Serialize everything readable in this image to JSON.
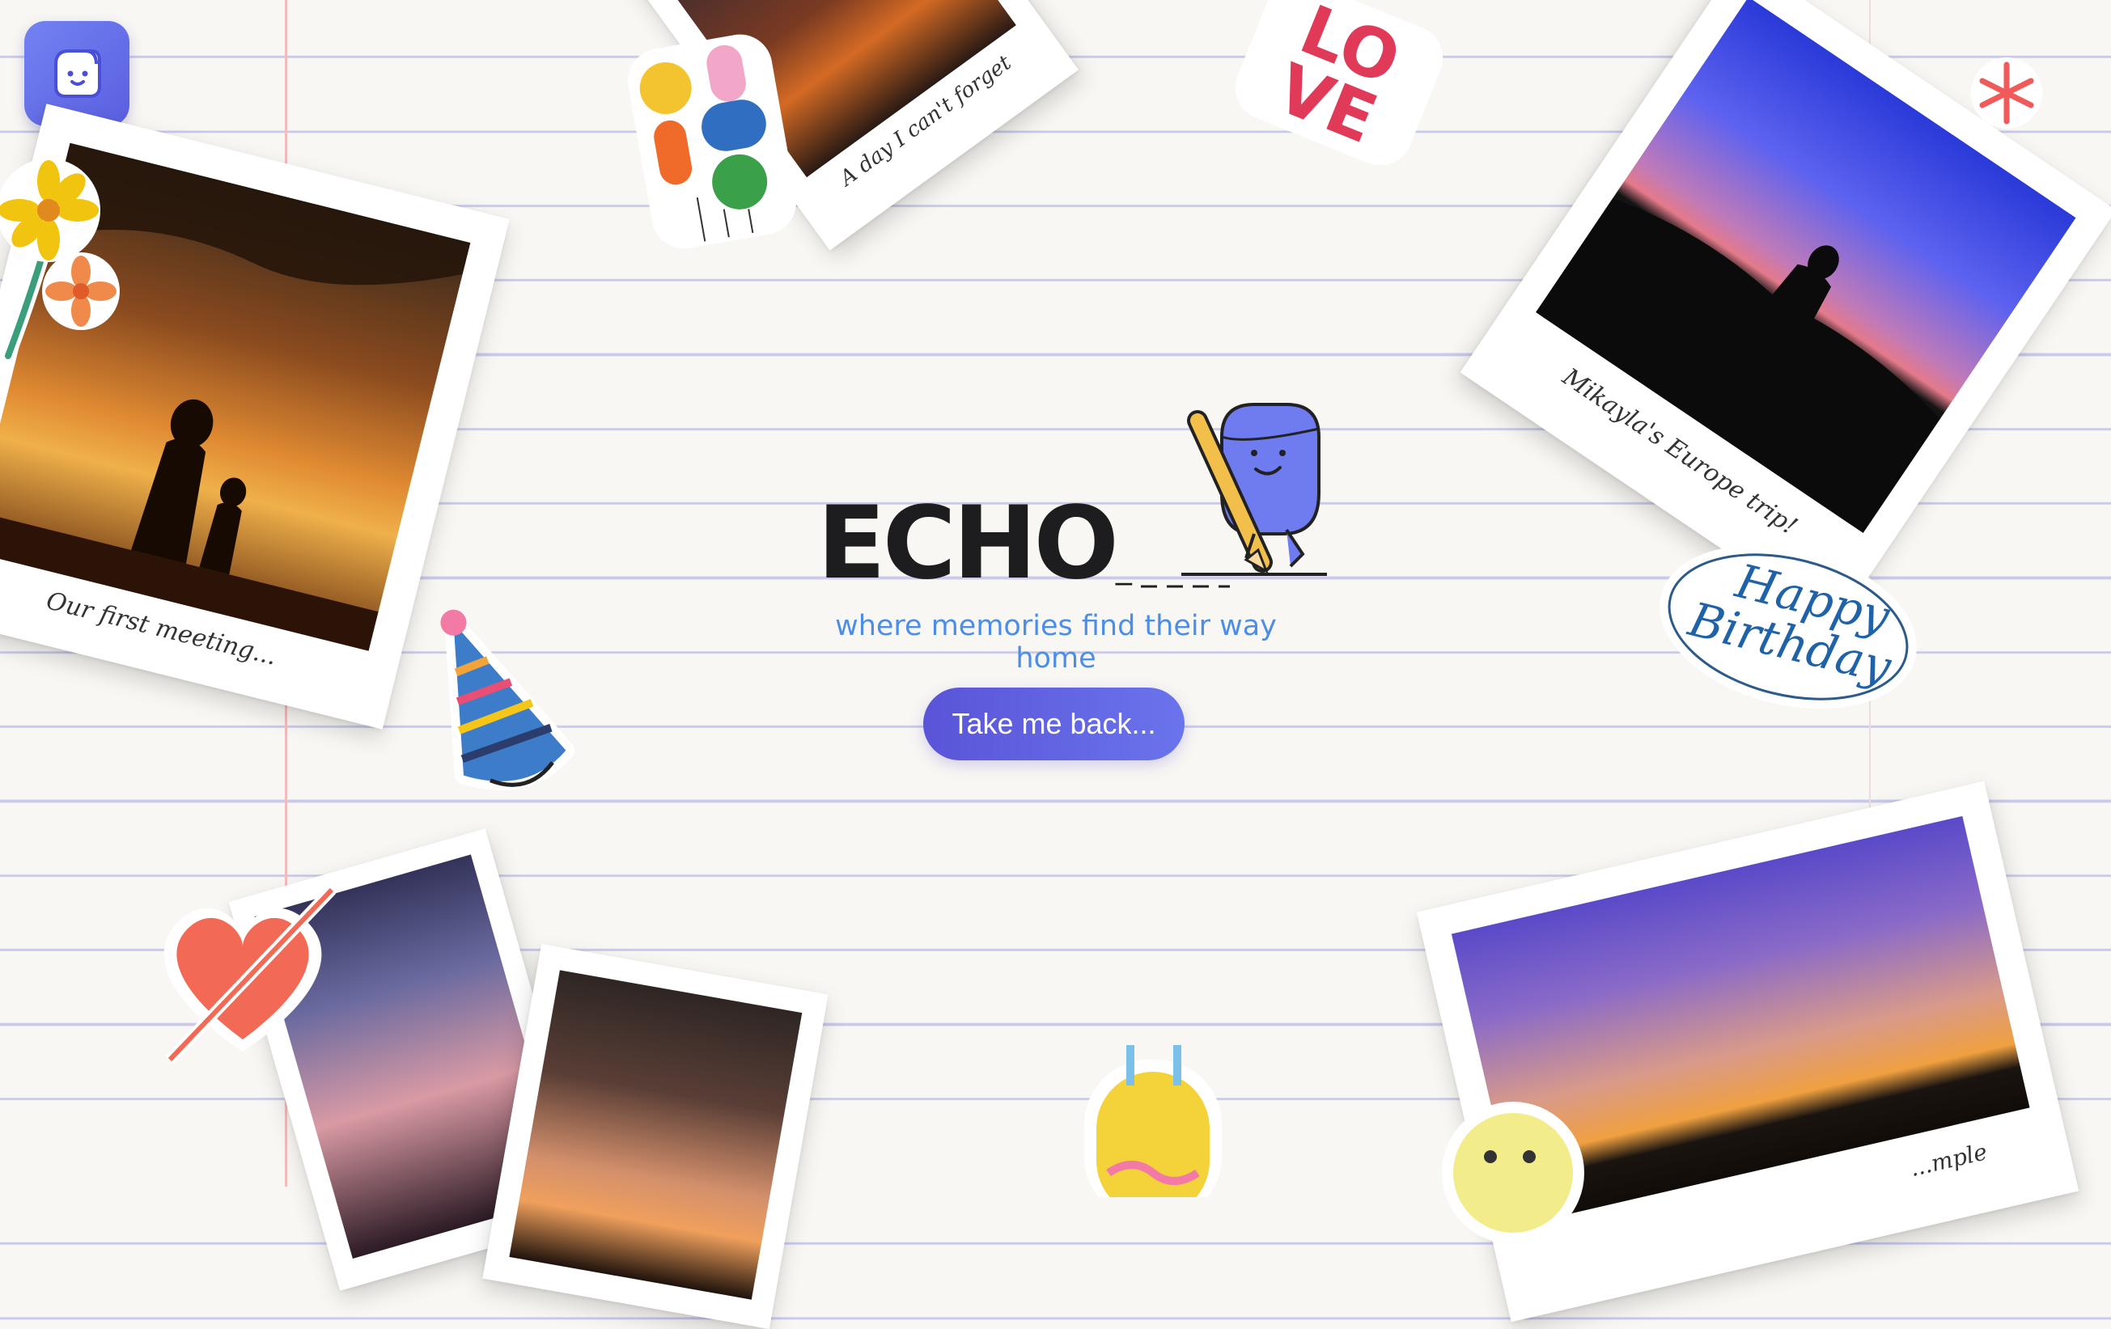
{
  "app": {
    "logo_icon": "smiley-face-icon",
    "title": "ECHO",
    "title_suffix": "_",
    "tagline": "where memories find their way home",
    "cta_label": "Take me back..."
  },
  "polaroids": [
    {
      "caption": "Our first meeting..."
    },
    {
      "caption": "A day I can't forget"
    },
    {
      "caption": "Mikayla's Europe trip!"
    },
    {
      "caption": ""
    },
    {
      "caption": ""
    },
    {
      "caption": "...mple"
    }
  ],
  "stickers": {
    "love": "LOVE",
    "birthday_line1": "Happy",
    "birthday_line2": "Birthday"
  },
  "colors": {
    "accent": "#5a54d8",
    "tagline": "#4c8ee6",
    "title": "#1d1d1f",
    "paper": "#f9f7f3",
    "rule_line": "#c9c9ef",
    "margin_line": "#f3bcbc"
  }
}
